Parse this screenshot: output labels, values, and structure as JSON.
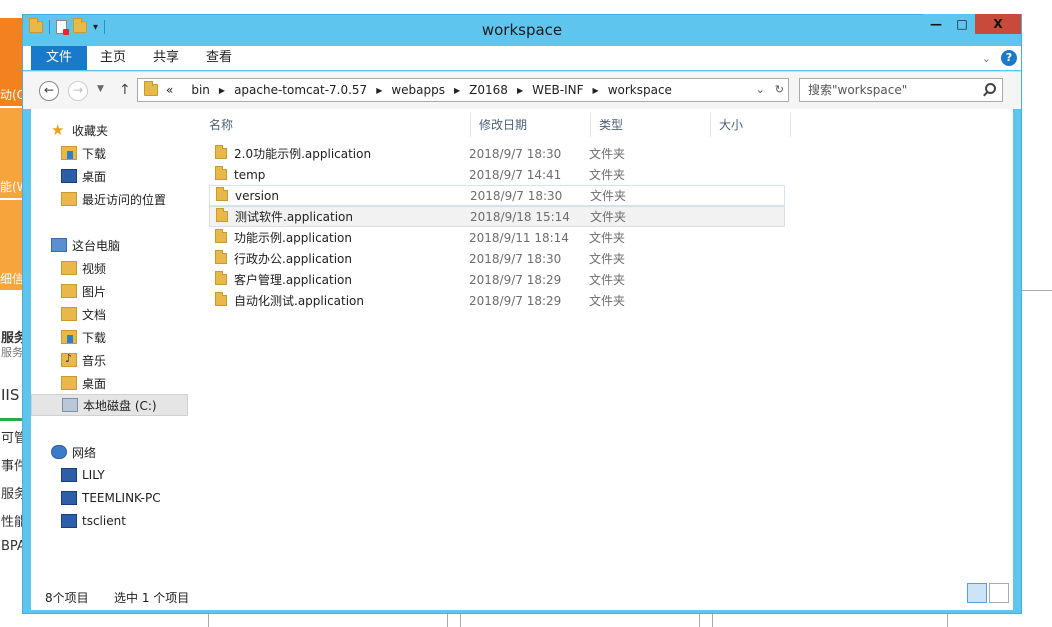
{
  "background": {
    "left_texts": [
      "动(Q",
      "能(W",
      "细信",
      "服务",
      "服务",
      "IIS",
      "可管",
      "事件",
      "服务",
      "性能",
      "BPA"
    ]
  },
  "window": {
    "title": "workspace",
    "buttons": {
      "minimize": "—",
      "maximize": "□",
      "close": "X"
    }
  },
  "ribbon": {
    "tabs": [
      "文件",
      "主页",
      "共享",
      "查看"
    ]
  },
  "nav": {
    "back": "←",
    "forward": "→",
    "up": "↑",
    "address_prefix": "«",
    "breadcrumbs": [
      "bin",
      "apache-tomcat-7.0.57",
      "webapps",
      "Z0168",
      "WEB-INF",
      "workspace"
    ],
    "search_placeholder": "搜索\"workspace\""
  },
  "sidebar": {
    "favorites": {
      "label": "收藏夹",
      "items": [
        "下载",
        "桌面",
        "最近访问的位置"
      ]
    },
    "this_pc": {
      "label": "这台电脑",
      "items": [
        "视频",
        "图片",
        "文档",
        "下载",
        "音乐",
        "桌面",
        "本地磁盘 (C:)"
      ]
    },
    "network": {
      "label": "网络",
      "items": [
        "LILY",
        "TEEMLINK-PC",
        "tsclient"
      ]
    }
  },
  "columns": [
    "名称",
    "修改日期",
    "类型",
    "大小"
  ],
  "files": [
    {
      "name": "2.0功能示例.application",
      "date": "2018/9/7 18:30",
      "type": "文件夹"
    },
    {
      "name": "temp",
      "date": "2018/9/7 14:41",
      "type": "文件夹"
    },
    {
      "name": "version",
      "date": "2018/9/7 18:30",
      "type": "文件夹"
    },
    {
      "name": "测试软件.application",
      "date": "2018/9/18 15:14",
      "type": "文件夹"
    },
    {
      "name": "功能示例.application",
      "date": "2018/9/11 18:14",
      "type": "文件夹"
    },
    {
      "name": "行政办公.application",
      "date": "2018/9/7 18:30",
      "type": "文件夹"
    },
    {
      "name": "客户管理.application",
      "date": "2018/9/7 18:29",
      "type": "文件夹"
    },
    {
      "name": "自动化测试.application",
      "date": "2018/9/7 18:29",
      "type": "文件夹"
    }
  ],
  "status": {
    "count": "8个项目",
    "selected": "选中 1 个项目"
  },
  "colors": {
    "title_bar": "#5ec6ee",
    "file_tab": "#1979ca",
    "close_button": "#c74a3a"
  }
}
